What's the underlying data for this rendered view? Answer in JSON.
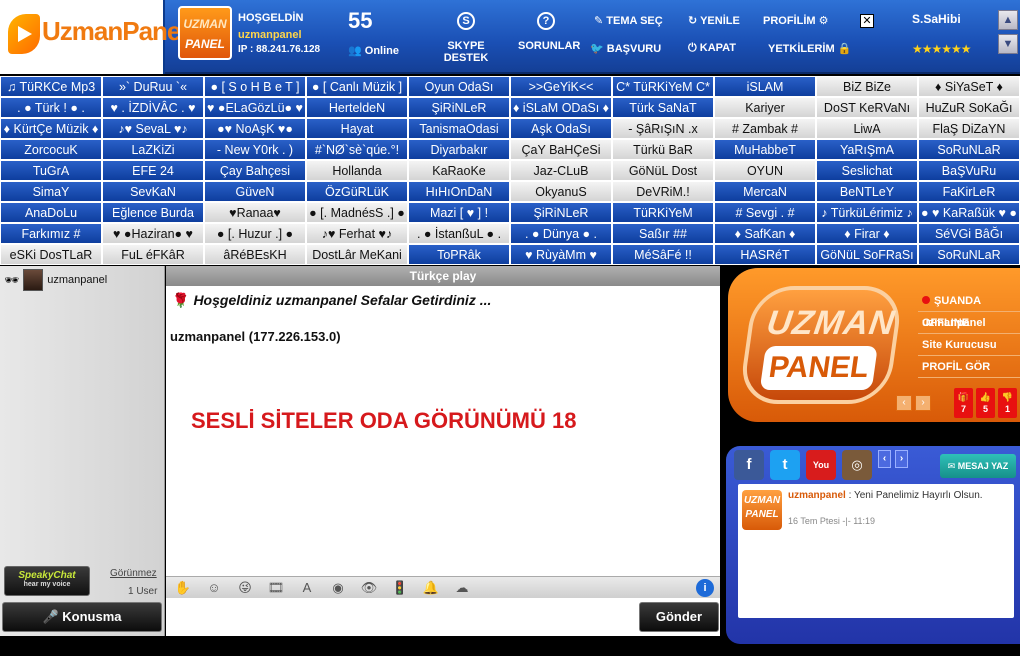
{
  "header": {
    "brand": "UzmanPanel",
    "logo_small": [
      "UZMAN",
      "PANEL"
    ],
    "greeting": "HOŞGELDİN",
    "username": "uzmanpanel",
    "ip": "IP : 88.241.76.128",
    "online_count": "55",
    "online_label": "Online",
    "skype": "SKYPE DESTEK",
    "sorunlar": "SORUNLAR",
    "tema": "TEMA SEÇ",
    "basvuru": "BAŞVURU",
    "yenile": "YENİLE",
    "kapat": "KAPAT",
    "profilim": "PROFİLİM",
    "yetkilerim": "YETKİLERİM",
    "owner": "S.SaHibi",
    "stars": "★★★★★★"
  },
  "rooms": [
    {
      "label": "♫ TüRKCe Mp3",
      "c": "b"
    },
    {
      "label": "»` DuRuu `«",
      "c": "b"
    },
    {
      "label": "● [ S o H B e T ]",
      "c": "b"
    },
    {
      "label": "● [ Canlı Müzik ]",
      "c": "b"
    },
    {
      "label": "Oyun OdaSı",
      "c": "b"
    },
    {
      "label": ">>GeYiK<<",
      "c": "b"
    },
    {
      "label": "C* TüRKiYeM C*",
      "c": "b"
    },
    {
      "label": "iSLAM",
      "c": "b"
    },
    {
      "label": "BiZ BiZe",
      "c": "g"
    },
    {
      "label": "♦ SiYaSeT ♦",
      "c": "g"
    },
    {
      "label": ". ● Türk ! ● .",
      "c": "b"
    },
    {
      "label": "♥ . İZDİVÂC . ♥",
      "c": "b"
    },
    {
      "label": "♥ ●ELaGözLü● ♥",
      "c": "b"
    },
    {
      "label": "HerteldeN",
      "c": "b"
    },
    {
      "label": "ŞiRiNLeR",
      "c": "b"
    },
    {
      "label": "♦ iSLaM ODaSı ♦",
      "c": "b"
    },
    {
      "label": "Türk SaNaT",
      "c": "b"
    },
    {
      "label": "Kariyer",
      "c": "g"
    },
    {
      "label": "DoST KeRVaNı",
      "c": "g"
    },
    {
      "label": "HuZuR SoKaĞı",
      "c": "g"
    },
    {
      "label": "♦ KürtÇe Müzik ♦",
      "c": "b"
    },
    {
      "label": "♪♥ SevaL ♥♪",
      "c": "b"
    },
    {
      "label": "●♥ NoAşK ♥●",
      "c": "b"
    },
    {
      "label": "Hayat",
      "c": "b"
    },
    {
      "label": "TanismaOdasi",
      "c": "b"
    },
    {
      "label": "Aşk OdaSı",
      "c": "b"
    },
    {
      "label": "- ŞâRıŞıN .x",
      "c": "g"
    },
    {
      "label": "# Zambak #",
      "c": "g"
    },
    {
      "label": "LiwA",
      "c": "g"
    },
    {
      "label": "FlaŞ DiZaYN",
      "c": "g"
    },
    {
      "label": "ZorcocuK",
      "c": "b"
    },
    {
      "label": "LaZKiZi",
      "c": "b"
    },
    {
      "label": "- New Y0rk . )",
      "c": "b"
    },
    {
      "label": "#`NØ`sè`qúe.°!",
      "c": "b"
    },
    {
      "label": "Diyarbakır",
      "c": "b"
    },
    {
      "label": "ÇaY BaHÇeSi",
      "c": "g"
    },
    {
      "label": "Türkü BaR",
      "c": "g"
    },
    {
      "label": "MuHabbeT",
      "c": "b"
    },
    {
      "label": "YaRıŞmA",
      "c": "b"
    },
    {
      "label": "SoRuNLaR",
      "c": "b"
    },
    {
      "label": "TuGrA",
      "c": "b"
    },
    {
      "label": "EFE  24",
      "c": "b"
    },
    {
      "label": "Çay Bahçesi",
      "c": "b"
    },
    {
      "label": "Hollanda",
      "c": "g"
    },
    {
      "label": "KaRaoKe",
      "c": "g"
    },
    {
      "label": "Jaz-CLuB",
      "c": "g"
    },
    {
      "label": "GöNüL Dost",
      "c": "g"
    },
    {
      "label": "OYUN",
      "c": "g"
    },
    {
      "label": "Seslichat",
      "c": "b"
    },
    {
      "label": "BaŞVuRu",
      "c": "b"
    },
    {
      "label": "SimaY",
      "c": "b"
    },
    {
      "label": "SevKaN",
      "c": "b"
    },
    {
      "label": "GüveN",
      "c": "b"
    },
    {
      "label": "ÖzGüRLüK",
      "c": "b"
    },
    {
      "label": "HıHıOnDaN",
      "c": "b"
    },
    {
      "label": "OkyanuS",
      "c": "g"
    },
    {
      "label": "DeVRiM.!",
      "c": "g"
    },
    {
      "label": "MercaN",
      "c": "b"
    },
    {
      "label": "BeNTLeY",
      "c": "b"
    },
    {
      "label": "FaKirLeR",
      "c": "b"
    },
    {
      "label": "AnaDoLu",
      "c": "b"
    },
    {
      "label": "Eğlence Burda",
      "c": "b"
    },
    {
      "label": "♥Ranaa♥",
      "c": "g"
    },
    {
      "label": "● [. MadnésS .] ●",
      "c": "g"
    },
    {
      "label": "Mazi [ ♥ ] !",
      "c": "b"
    },
    {
      "label": "ŞiRiNLeR",
      "c": "b"
    },
    {
      "label": "TüRKiYeM",
      "c": "b"
    },
    {
      "label": "# Sevgi . #",
      "c": "b"
    },
    {
      "label": "♪ TürküLérimiz ♪",
      "c": "b"
    },
    {
      "label": "● ♥ KaRaßük ♥ ●",
      "c": "b"
    },
    {
      "label": "Farkımız #",
      "c": "b"
    },
    {
      "label": "♥ ●Haziran● ♥",
      "c": "g"
    },
    {
      "label": "● [. Huzur .] ●",
      "c": "g"
    },
    {
      "label": "♪♥ Ferhat ♥♪",
      "c": "g"
    },
    {
      "label": ". ● İstanßuL ● .",
      "c": "g"
    },
    {
      "label": ". ● Dünya ● .",
      "c": "b"
    },
    {
      "label": "Saßır ##",
      "c": "b"
    },
    {
      "label": "♦ SafKan ♦",
      "c": "b"
    },
    {
      "label": "♦ Firar ♦",
      "c": "b"
    },
    {
      "label": "SéVGi BâĞı",
      "c": "b"
    },
    {
      "label": "eSKi DosTLaR",
      "c": "g"
    },
    {
      "label": "FuL éFKâR",
      "c": "g"
    },
    {
      "label": "âRéBEsKH",
      "c": "g"
    },
    {
      "label": "DostLâr MeKani",
      "c": "g"
    },
    {
      "label": "ToPRâk",
      "c": "b"
    },
    {
      "label": "♥ RùyàMm ♥",
      "c": "b"
    },
    {
      "label": "MéSâFé !!",
      "c": "b"
    },
    {
      "label": "HASRéT",
      "c": "b"
    },
    {
      "label": "GöNüL SoFRaSı",
      "c": "b"
    },
    {
      "label": "SoRuNLaR",
      "c": "b"
    }
  ],
  "userlist": {
    "user": "uzmanpanel",
    "speaky": "SpeakyChat",
    "speaky_sub": "hear my voice",
    "gorunmez": "Görünmez",
    "count": "1 User",
    "konusma": "Konusma"
  },
  "chat": {
    "title": "Türkçe play",
    "welcome": "Hoşgeldiniz uzmanpanel Sefalar Getirdiniz ...",
    "ipline": "uzmanpanel (177.226.153.0)",
    "overlay": "SESLİ SİTELER ODA GÖRÜNÜMÜ 18",
    "send": "Gönder",
    "input_placeholder": ""
  },
  "promo": {
    "brand_top": "UZMAN",
    "brand_bottom": "PANEL",
    "menu": [
      "ŞUANDA OFFLINE",
      "uzmanpanel",
      "Site Kurucusu",
      "PROFİL GÖR"
    ],
    "votes": [
      "7",
      "5",
      "1"
    ]
  },
  "social": {
    "mesaj": "MESAJ YAZ",
    "post_user": "uzmanpanel",
    "post_text": "Yeni Panelimiz Hayırlı Olsun.",
    "post_date": "16 Tem Ptesi -|- 11:19",
    "fav": [
      "UZMAN",
      "PANEL"
    ]
  }
}
